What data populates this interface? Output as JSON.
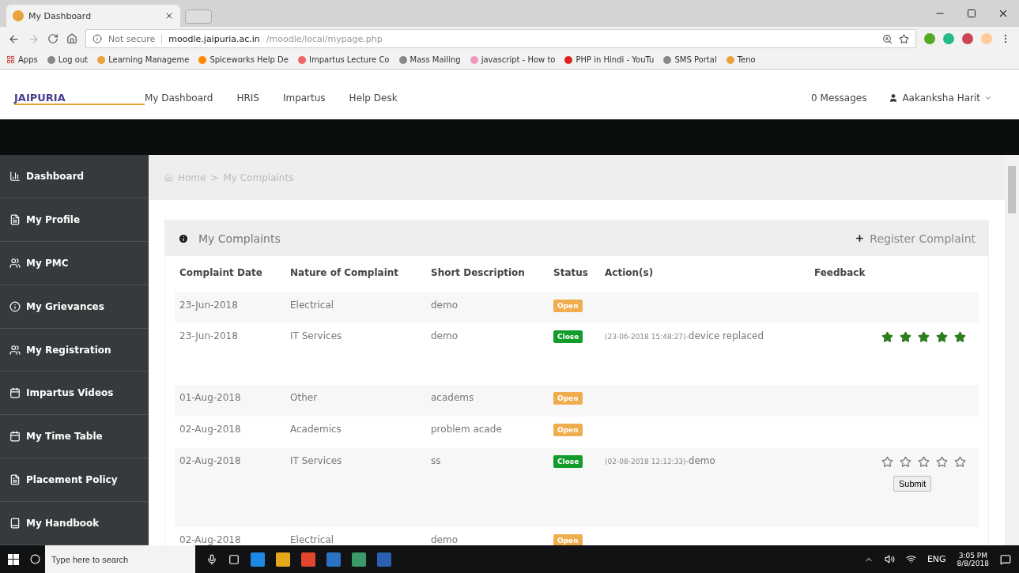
{
  "browser": {
    "tab_title": "My Dashboard",
    "security": "Not secure",
    "url_host": "moodle.jaipuria.ac.in",
    "url_path": "/moodle/local/mypage.php",
    "bookmarks": [
      "Apps",
      "Log out",
      "Learning Manageme",
      "Spiceworks Help De",
      "Impartus Lecture Co",
      "Mass Mailing",
      "javascript - How to",
      "PHP in Hindi - YouTu",
      "SMS Portal",
      "Teno"
    ]
  },
  "site": {
    "logo": "JAIPURIA",
    "nav": [
      "My Dashboard",
      "HRIS",
      "Impartus",
      "Help Desk"
    ],
    "messages": "0 Messages",
    "user": "Aakanksha Harit"
  },
  "sidebar": {
    "items": [
      {
        "label": "Dashboard",
        "kind": "chart"
      },
      {
        "label": "My Profile",
        "kind": "file"
      },
      {
        "label": "My PMC",
        "kind": "group"
      },
      {
        "label": "My Grievances",
        "kind": "info"
      },
      {
        "label": "My Registration",
        "kind": "group"
      },
      {
        "label": "Impartus Videos",
        "kind": "calendar"
      },
      {
        "label": "My Time Table",
        "kind": "calendar"
      },
      {
        "label": "Placement Policy",
        "kind": "file"
      },
      {
        "label": "My Handbook",
        "kind": "book"
      }
    ]
  },
  "breadcrumb": {
    "items": [
      "Home",
      "My Complaints"
    ],
    "separator": ">"
  },
  "panel": {
    "title": "My Complaints",
    "action": "Register Complaint"
  },
  "table": {
    "columns": [
      "Complaint Date",
      "Nature of Complaint",
      "Short Description",
      "Status",
      "Action(s)",
      "Feedback"
    ],
    "rows": [
      {
        "date": "23-Jun-2018",
        "nature": "Electrical",
        "description": "demo",
        "status": {
          "label": "Open",
          "color": "#f0ad4e"
        }
      },
      {
        "date": "23-Jun-2018",
        "nature": "IT Services",
        "description": "demo",
        "status": {
          "label": "Close",
          "color": "#119c2b"
        },
        "action_time": "(23-06-2018 15:48:27)-",
        "action_text": "device replaced",
        "feedback": {
          "stars": 5
        }
      },
      {
        "date": "01-Aug-2018",
        "nature": "Other",
        "description": "academs",
        "status": {
          "label": "Open",
          "color": "#f0ad4e"
        }
      },
      {
        "date": "02-Aug-2018",
        "nature": "Academics",
        "description": "problem acade",
        "status": {
          "label": "Open",
          "color": "#f0ad4e"
        }
      },
      {
        "date": "02-Aug-2018",
        "nature": "IT Services",
        "description": "ss",
        "status": {
          "label": "Close",
          "color": "#119c2b"
        },
        "action_time": "(02-08-2018 12:12:33)-",
        "action_text": "demo",
        "feedback": {
          "stars": 0,
          "button": "Submit"
        }
      },
      {
        "date": "02-Aug-2018",
        "nature": "Electrical",
        "description": "demo",
        "status": {
          "label": "Open",
          "color": "#f0ad4e"
        }
      }
    ]
  },
  "taskbar": {
    "search_placeholder": "Type here to search",
    "language": "ENG",
    "time": "3:05 PM",
    "date": "8/8/2018"
  }
}
